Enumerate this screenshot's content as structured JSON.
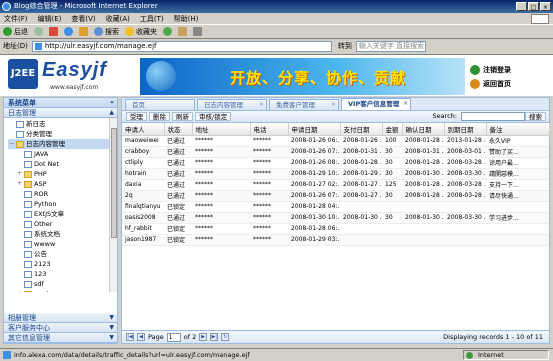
{
  "window": {
    "title": "Blog综合管理 - Microsoft Internet Explorer"
  },
  "menu": [
    "文件(F)",
    "编辑(E)",
    "查看(V)",
    "收藏(A)",
    "工具(T)",
    "帮助(H)"
  ],
  "toolbar": {
    "back": "后退",
    "search": "搜索",
    "favorites": "收藏夹"
  },
  "address": {
    "label": "地址(D)",
    "url": "http://ulr.easyjf.com/manage.ejf",
    "go": "转到",
    "search_placeholder": "输入关键字 直接搜索"
  },
  "banner": {
    "brand": "Easyjf",
    "site": "www.easyjf.com",
    "slogan": "开放、分享、协作、贡献",
    "links": [
      "注销登录",
      "返回首页"
    ]
  },
  "left": {
    "title": "系统菜单",
    "section": "日志管理",
    "tree": [
      {
        "label": "新日志",
        "indent": 1,
        "type": "doc"
      },
      {
        "label": "分类管理",
        "indent": 1,
        "type": "doc"
      },
      {
        "label": "日志内容管理",
        "indent": 1,
        "type": "folder",
        "open": true
      },
      {
        "label": "JAVA",
        "indent": 2,
        "type": "doc"
      },
      {
        "label": "Dot Net",
        "indent": 2,
        "type": "doc"
      },
      {
        "label": "PHP",
        "indent": 2,
        "type": "folder"
      },
      {
        "label": "ASP",
        "indent": 2,
        "type": "folder"
      },
      {
        "label": "ROR",
        "indent": 2,
        "type": "doc"
      },
      {
        "label": "Python",
        "indent": 2,
        "type": "doc"
      },
      {
        "label": "EXtJS文章",
        "indent": 2,
        "type": "doc"
      },
      {
        "label": "Other",
        "indent": 2,
        "type": "doc"
      },
      {
        "label": "系统文档",
        "indent": 2,
        "type": "doc"
      },
      {
        "label": "wwww",
        "indent": 2,
        "type": "doc"
      },
      {
        "label": "公告",
        "indent": 2,
        "type": "doc"
      },
      {
        "label": "2123",
        "indent": 2,
        "type": "doc"
      },
      {
        "label": "123",
        "indent": 2,
        "type": "doc"
      },
      {
        "label": "sdf",
        "indent": 2,
        "type": "doc"
      },
      {
        "label": "gugi",
        "indent": 2,
        "type": "folder"
      }
    ],
    "accordion": [
      "相册管理",
      "客户服务中心",
      "其它信息管理"
    ]
  },
  "tabs": [
    {
      "label": "首页",
      "active": false
    },
    {
      "label": "日志内容管理",
      "active": false
    },
    {
      "label": "免费客户管理",
      "active": false
    },
    {
      "label": "VIP客户信息管理",
      "active": true
    }
  ],
  "grid_toolbar": {
    "buttons": [
      "受理",
      "删除",
      "刷新",
      "审核/锁定"
    ],
    "search_label": "Search:",
    "search_button": "搜索"
  },
  "grid": {
    "columns": [
      "申请人",
      "状态",
      "地址",
      "电话",
      "申请日期",
      "支付日期",
      "金额",
      "确认日期",
      "到期日期",
      "备注"
    ],
    "rows": [
      [
        "maoweiwei",
        "已通过",
        "******",
        "******",
        "2008-01-26 06:...",
        "2008-01-26 ...",
        "100",
        "2008-01-28 ...",
        "2013-01-28 ...",
        "永久VIP"
      ],
      [
        "crabboy",
        "已通过",
        "******",
        "******",
        "2008-01-26 07:...",
        "2008-01-31 ...",
        "30",
        "2008-01-31 ...",
        "2008-03-01 ...",
        "赞助了买..."
      ],
      [
        "ctliply",
        "已通过",
        "******",
        "******",
        "2008-01-26 08:...",
        "2008-01-28 ...",
        "30",
        "2008-01-28 ...",
        "2008-03-28 ...",
        "谅用户最..."
      ],
      [
        "hotrain",
        "已通过",
        "******",
        "******",
        "2008-01-29 10:...",
        "2008-01-29 ...",
        "30",
        "2008-01-30 ...",
        "2008-03-30 ...",
        "請開惡模..."
      ],
      [
        "daxia",
        "已通过",
        "******",
        "******",
        "2008-01-27 02:...",
        "2008-01-27 ...",
        "125",
        "2008-01-28 ...",
        "2008-03-28 ...",
        "支持一下..."
      ],
      [
        "2q",
        "已通过",
        "******",
        "******",
        "2008-01-26 07:...",
        "2008-01-27 ...",
        "30",
        "2008-01-28 ...",
        "2008-03-28 ...",
        "请尽快通..."
      ],
      [
        "finalqtianyu",
        "已锁定",
        "******",
        "******",
        "2008-01-28 04:...",
        "",
        "",
        "",
        "",
        ""
      ],
      [
        "oasis2008",
        "已通过",
        "******",
        "******",
        "2008-01-30 10:...",
        "2008-01-30 ...",
        "30",
        "2008-01-30 ...",
        "2008-03-30 ...",
        "学习进步..."
      ],
      [
        "hf_rabbit",
        "已锁定",
        "******",
        "******",
        "2008-01-28 06:...",
        "",
        "",
        "",
        "",
        ""
      ],
      [
        "jason1987",
        "已锁定",
        "******",
        "******",
        "2008-01-29 03:...",
        "",
        "",
        "",
        "",
        ""
      ]
    ]
  },
  "pager": {
    "page_label": "Page",
    "page_value": "1",
    "of_label": "of 2",
    "display": "Displaying records 1 - 10 of 11"
  },
  "status": {
    "text": "info.alexa.com/data/details/traffic_details?url=ulr.easyjf.com/manage.ejf",
    "zone": "Internet"
  }
}
